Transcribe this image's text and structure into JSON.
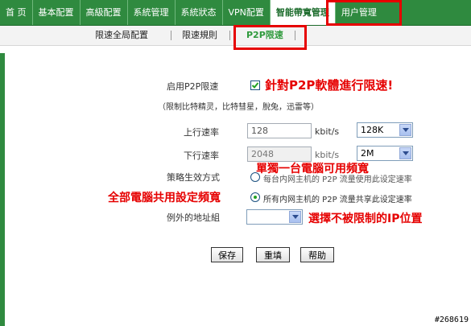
{
  "nav": {
    "items": [
      "首 页",
      "基本配置",
      "高級配置",
      "系統管理",
      "系統狀态",
      "VPN配置",
      "智能帶寬管理",
      "用户管理"
    ],
    "active_index": 6
  },
  "subnav": {
    "items": [
      "限速全局配置",
      "限速規則",
      "P2P限速"
    ],
    "active_index": 2
  },
  "form": {
    "p2p_label": "启用P2P限速",
    "p2p_checked": true,
    "p2p_note": "（限制比特精灵，比特彗星，脫兔，迅雷等）",
    "upload_label": "上行速率",
    "upload_value": "128",
    "upload_unit": "kbit/s",
    "upload_select": "128K",
    "download_label": "下行速率",
    "download_value": "2048",
    "download_unit": "kbit/s",
    "download_select": "2M",
    "policy_label": "策略生效方式",
    "policy_option1": "每台内网主机的 P2P 流量使用此设定速率",
    "policy_option2": "所有内网主机的 P2P 流量共享此设定速率",
    "policy_selected": 2,
    "exception_label": "例外的地址組",
    "exception_value": ""
  },
  "annotations": {
    "p2p": "針對P2P軟體進行限速!",
    "single": "單獨一台電腦可用頻寬",
    "all": "全部電腦共用設定頻寬",
    "exception": "選擇不被限制的IP位置"
  },
  "buttons": {
    "save": "保存",
    "reset": "重填",
    "help": "帮助"
  },
  "watermark": "#268619",
  "colors": {
    "nav_green": "#2f8a3f",
    "highlight_red": "#e60000",
    "active_sub": "#2f9a3c"
  }
}
